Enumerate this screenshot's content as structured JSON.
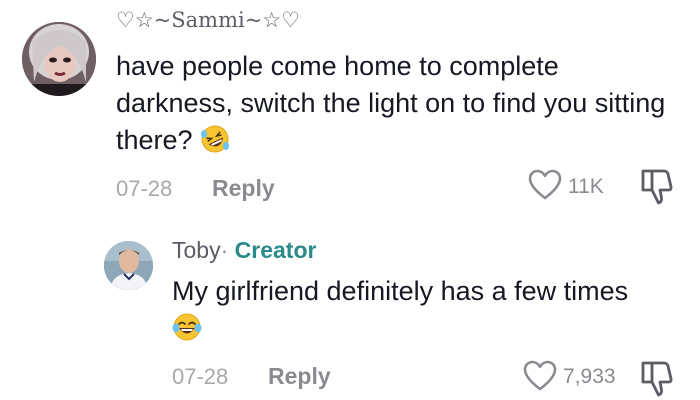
{
  "comments": [
    {
      "username": "♡☆~Sammi~☆♡",
      "text": "have people come home to complete darkness, switch the light on to find you sitting there?",
      "emoji": "rolling-on-floor-laughing",
      "date": "07-28",
      "reply_label": "Reply",
      "likes": "11K"
    }
  ],
  "replies": [
    {
      "username": "Toby",
      "separator": "·",
      "badge": "Creator",
      "text": "My girlfriend definitely has a few times",
      "emoji": "face-with-tears-of-joy",
      "date": "07-28",
      "reply_label": "Reply",
      "likes": "7,933"
    }
  ],
  "colors": {
    "text": "#161823",
    "secondary": "#8a8b91",
    "creator": "#2b8a8a"
  }
}
